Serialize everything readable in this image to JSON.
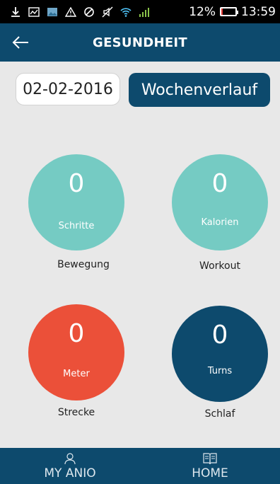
{
  "status_bar": {
    "battery": "12%",
    "battery_level": 0.12,
    "time": "13:59",
    "icons": [
      "download-icon",
      "chart-icon",
      "image-icon",
      "warning-icon",
      "blocked-icon",
      "mute-icon",
      "wifi-icon",
      "signal-icon"
    ]
  },
  "header": {
    "title": "GESUNDHEIT",
    "back_icon": "arrow-left-icon"
  },
  "controls": {
    "date": "02-02-2016",
    "week_button_label": "Wochenverlauf"
  },
  "metrics": [
    {
      "value": "0",
      "unit": "Schritte",
      "label": "Bewegung",
      "color": "#75cbc3"
    },
    {
      "value": "0",
      "unit": "Kalorien",
      "label": "Workout",
      "color": "#75cbc3"
    },
    {
      "value": "0",
      "unit": "Meter",
      "label": "Strecke",
      "color": "#eb5039"
    },
    {
      "value": "0",
      "unit": "Turns",
      "label": "Schlaf",
      "color": "#0d4a6d"
    }
  ],
  "bottom_nav": {
    "items": [
      {
        "label": "MY ANIO",
        "icon": "person-icon"
      },
      {
        "label": "HOME",
        "icon": "book-icon"
      }
    ]
  },
  "colors": {
    "primary": "#0d4a6d",
    "teal": "#75cbc3",
    "red": "#eb5039",
    "background": "#e8e8e8"
  }
}
